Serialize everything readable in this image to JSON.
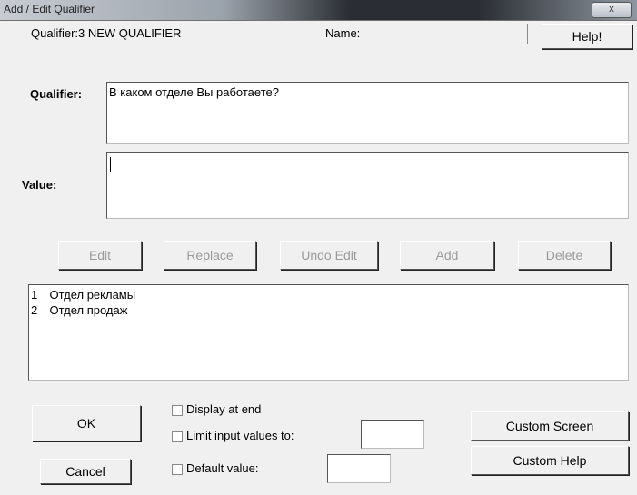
{
  "window": {
    "title": "Add / Edit Qualifier",
    "close_label": "x"
  },
  "header": {
    "qualifier_info": "Qualifier:3  NEW QUALIFIER",
    "name_label": "Name:",
    "help_button": "Help!"
  },
  "qualifier": {
    "label": "Qualifier:",
    "text": "В каком отделе Вы работаете?"
  },
  "value": {
    "label": "Value:",
    "text": ""
  },
  "actions": {
    "edit": "Edit",
    "replace": "Replace",
    "undo_edit": "Undo Edit",
    "add": "Add",
    "delete": "Delete"
  },
  "values_list": [
    {
      "num": "1",
      "text": "Отдел рекламы"
    },
    {
      "num": "2",
      "text": "Отдел продаж"
    }
  ],
  "footer": {
    "ok": "OK",
    "cancel": "Cancel",
    "display_at_end": "Display at end",
    "limit_input": "Limit input values to:",
    "limit_value": "",
    "default_value": "Default value:",
    "default_value_input": "",
    "custom_screen": "Custom Screen",
    "custom_help": "Custom Help"
  }
}
